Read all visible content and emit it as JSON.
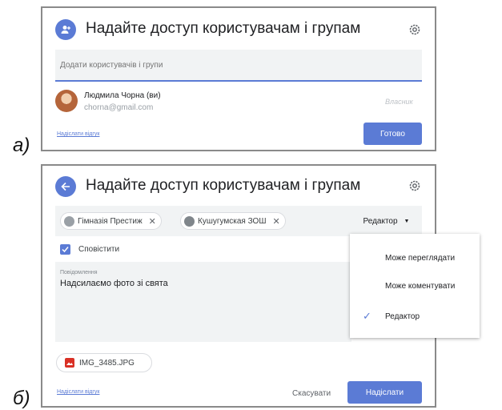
{
  "labels": {
    "a": "а)",
    "b": "б)"
  },
  "dialog_a": {
    "title": "Надайте доступ користувачам і групам",
    "add_placeholder": "Додати користувачів і групи",
    "owner": {
      "name": "Людмила Чорна (ви)",
      "email": "chorna@gmail.com",
      "role": "Власник"
    },
    "link": "Надіслати відгук",
    "done_button": "Готово"
  },
  "dialog_b": {
    "title": "Надайте доступ користувачам і групам",
    "chips": [
      {
        "label": "Гімназія Престиж",
        "icon": "group-icon"
      },
      {
        "label": "Кушугумская ЗОШ",
        "icon": "group-icon"
      }
    ],
    "role_selected": "Редактор",
    "notify_label": "Сповістити",
    "message_label": "Повідомлення",
    "message_text": "Надсилаємо фото зі свята",
    "attachment": "IMG_3485.JPG",
    "link": "Надіслати відгук",
    "cancel_button": "Скасувати",
    "send_button": "Надіслати"
  },
  "role_menu": {
    "items": [
      "Може переглядати",
      "Може коментувати",
      "Редактор"
    ],
    "checked": "Редактор"
  },
  "colors": {
    "accent": "#5b7bd5",
    "field_bg": "#f1f3f4"
  }
}
